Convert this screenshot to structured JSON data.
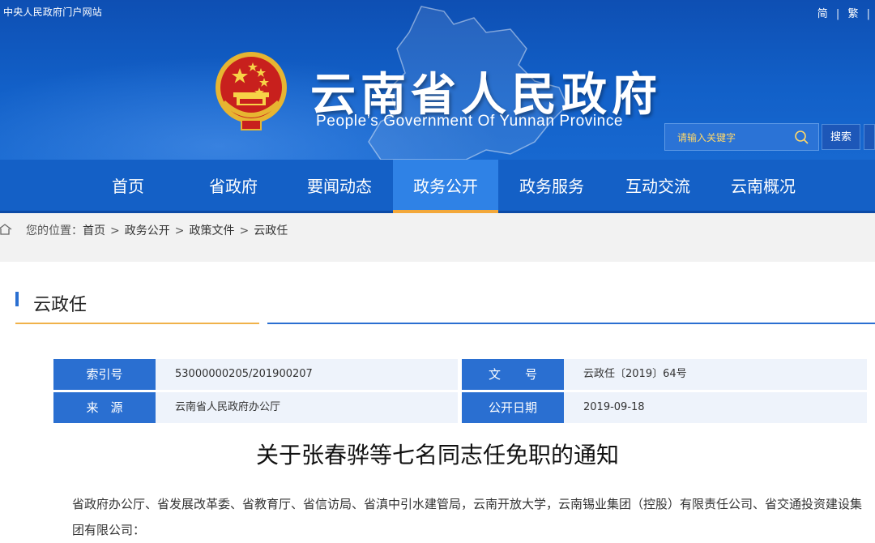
{
  "header": {
    "portal_link": "中央人民政府门户网站",
    "lang_simplified": "简",
    "lang_sep": "|",
    "lang_traditional": "繁",
    "title": "云南省人民政府",
    "subtitle": "People’s Government Of Yunnan Province",
    "search_placeholder": "请输入关键字",
    "search_button": "搜索"
  },
  "nav": {
    "items": [
      {
        "label": "首页"
      },
      {
        "label": "省政府"
      },
      {
        "label": "要闻动态"
      },
      {
        "label": "政务公开"
      },
      {
        "label": "政务服务"
      },
      {
        "label": "互动交流"
      },
      {
        "label": "云南概况"
      }
    ],
    "active_label": "政务公开"
  },
  "breadcrumb": {
    "prefix": "您的位置：",
    "items": [
      "首页",
      "政务公开",
      "政策文件",
      "云政任"
    ],
    "separator": ">"
  },
  "section": {
    "title": "云政任"
  },
  "meta": {
    "index_label": "索引号",
    "index_value": "53000000205/201900207",
    "docno_label": "文　　号",
    "docno_value": "云政任〔2019〕64号",
    "source_label": "来　源",
    "source_value": "云南省人民政府办公厅",
    "date_label": "公开日期",
    "date_value": "2019-09-18"
  },
  "document": {
    "title": "关于张春骅等七名同志任免职的通知",
    "recipients": "省政府办公厅、省发展改革委、省教育厅、省信访局、省滇中引水建管局，云南开放大学，云南锡业集团（控股）有限责任公司、省交通投资建设集团有限公司："
  },
  "colors": {
    "header_blue": "#1260c8",
    "nav_active": "#2f82e6",
    "accent_gold": "#f0b24a",
    "label_blue": "#2a6fd1"
  }
}
